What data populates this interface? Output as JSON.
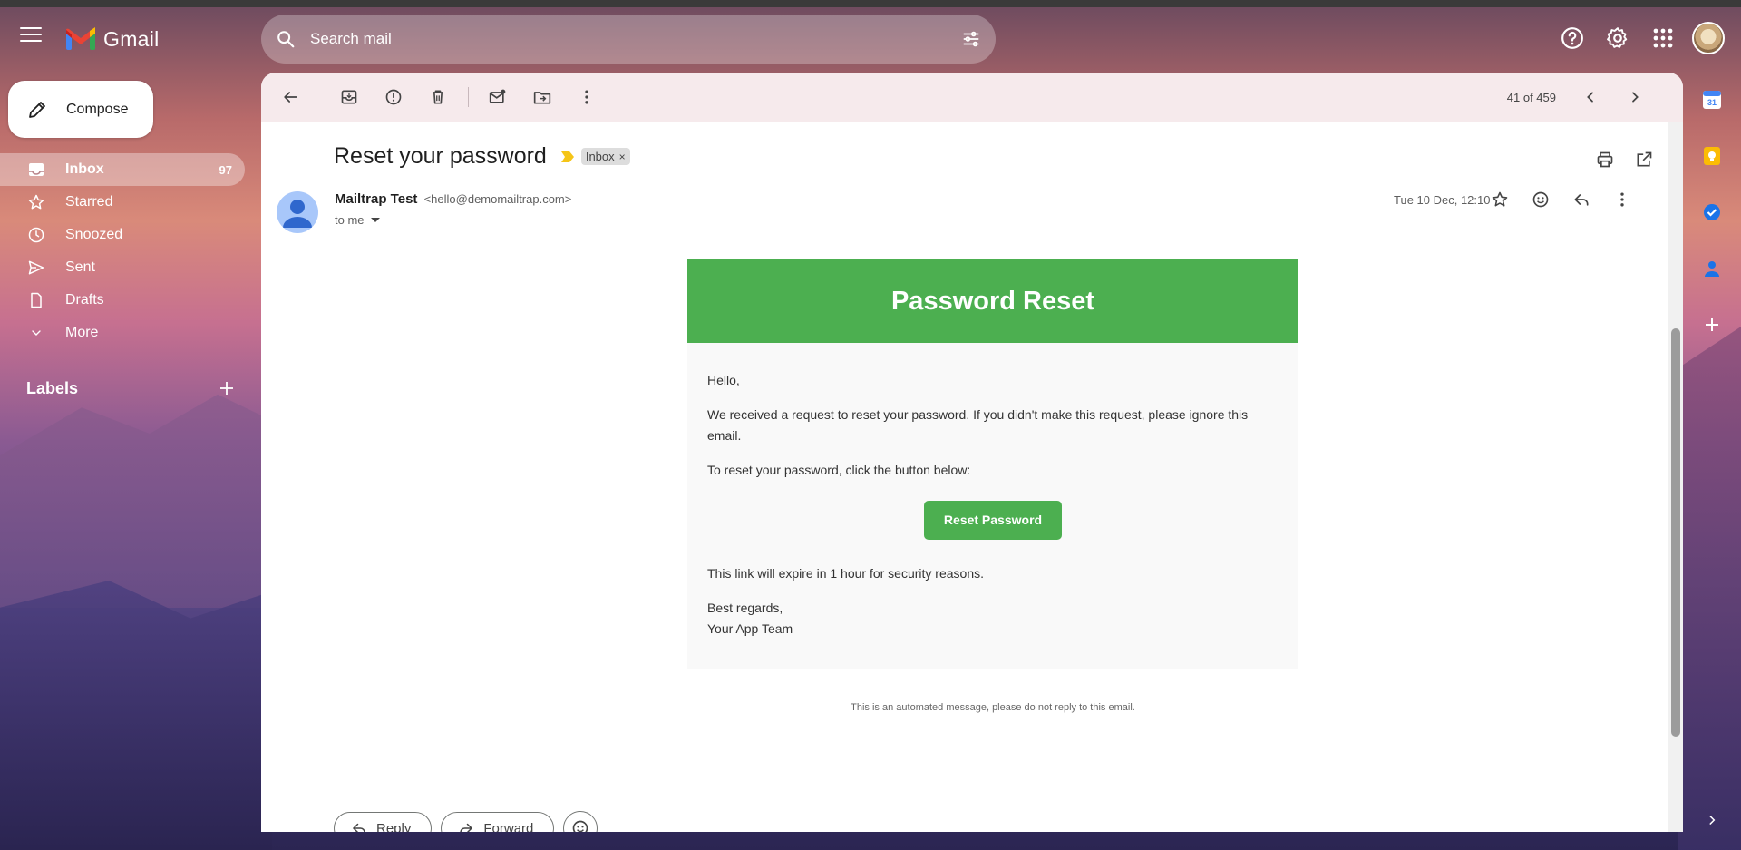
{
  "app": {
    "name": "Gmail"
  },
  "search": {
    "placeholder": "Search mail"
  },
  "compose": {
    "label": "Compose"
  },
  "nav": {
    "items": [
      {
        "label": "Inbox",
        "count": "97",
        "icon": "inbox-icon"
      },
      {
        "label": "Starred",
        "count": "",
        "icon": "star-icon"
      },
      {
        "label": "Snoozed",
        "count": "",
        "icon": "clock-icon"
      },
      {
        "label": "Sent",
        "count": "",
        "icon": "send-icon"
      },
      {
        "label": "Drafts",
        "count": "",
        "icon": "draft-icon"
      },
      {
        "label": "More",
        "count": "",
        "icon": "chevron-down-icon"
      }
    ],
    "labels_heading": "Labels"
  },
  "toolbar": {
    "pager": "41 of 459"
  },
  "message": {
    "subject": "Inbox",
    "title": "Reset your password",
    "label_chip": "Inbox",
    "sender_name": "Mailtrap Test",
    "sender_email": "<hello@demomailtrap.com>",
    "to": "to me",
    "date": "Tue 10 Dec, 12:10"
  },
  "email": {
    "banner_title": "Password Reset",
    "greeting": "Hello,",
    "para1": "We received a request to reset your password. If you didn't make this request, please ignore this email.",
    "para2": "To reset your password, click the button below:",
    "button_label": "Reset Password",
    "para3": "This link will expire in 1 hour for security reasons.",
    "signoff": "Best regards,",
    "team": "Your App Team",
    "footer": "This is an automated message, please do not reply to this email."
  },
  "reply_actions": {
    "reply": "Reply",
    "forward": "Forward"
  },
  "colors": {
    "accent_green": "#4caf50",
    "gmail_red": "#ea4335"
  }
}
